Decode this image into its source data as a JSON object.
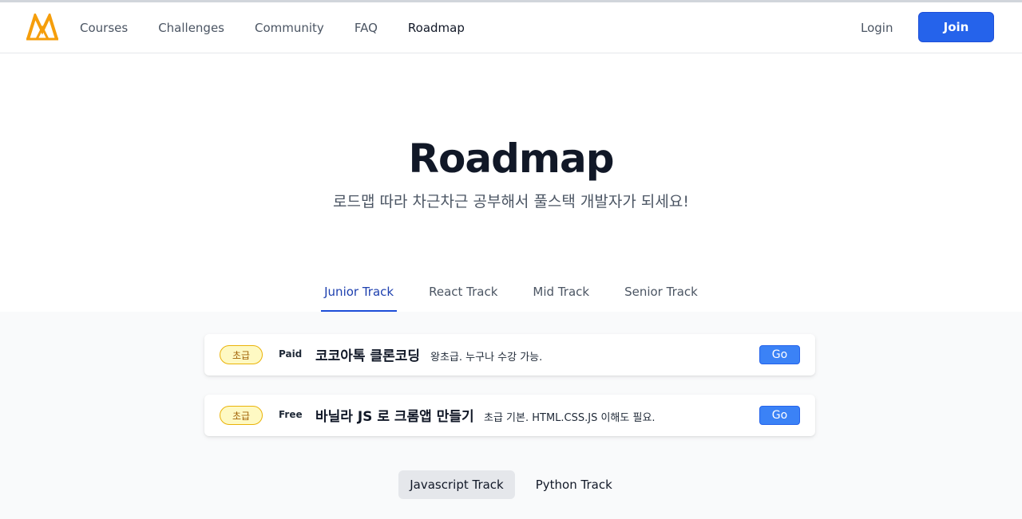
{
  "nav": {
    "items": [
      {
        "label": "Courses"
      },
      {
        "label": "Challenges"
      },
      {
        "label": "Community"
      },
      {
        "label": "FAQ"
      },
      {
        "label": "Roadmap"
      }
    ],
    "active": "Roadmap",
    "login_label": "Login",
    "join_label": "Join"
  },
  "hero": {
    "title": "Roadmap",
    "subtitle": "로드맵 따라 차근차근 공부해서 풀스택 개발자가 되세요!"
  },
  "tabs": [
    {
      "label": "Junior Track"
    },
    {
      "label": "React Track"
    },
    {
      "label": "Mid Track"
    },
    {
      "label": "Senior Track"
    }
  ],
  "courses": [
    {
      "level": "초급",
      "price": "Paid",
      "title": "코코아톡 클론코딩",
      "desc": "왕초급. 누구나 수강 가능.",
      "go_label": "Go"
    },
    {
      "level": "초급",
      "price": "Free",
      "title": "바닐라 JS 로 크롬앱 만들기",
      "desc": "초급 기본. HTML.CSS.JS 이해도 필요.",
      "go_label": "Go"
    }
  ],
  "languages": [
    {
      "label": "Javascript Track"
    },
    {
      "label": "Python Track"
    }
  ],
  "colors": {
    "accent": "#2563eb",
    "badge_border": "#eab308",
    "badge_bg": "#fef9c3",
    "logo": "#f59e0b"
  }
}
